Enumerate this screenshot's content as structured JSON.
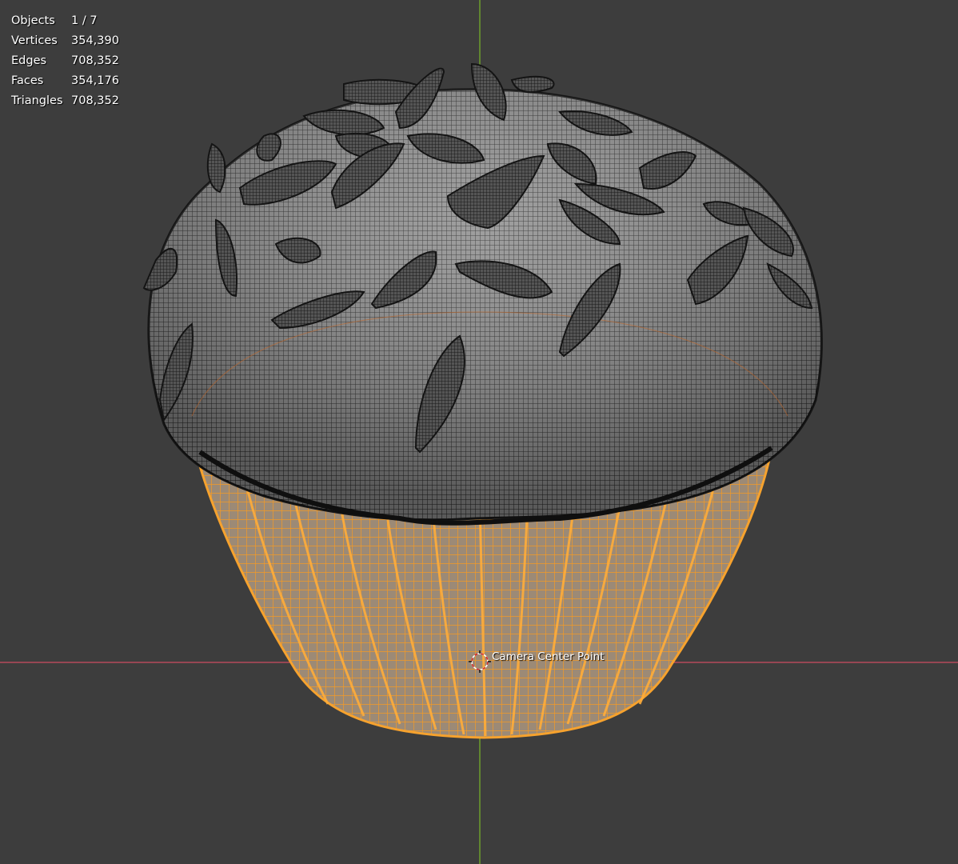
{
  "stats": [
    {
      "label": "Objects",
      "value": "1 / 7"
    },
    {
      "label": "Vertices",
      "value": "354,390"
    },
    {
      "label": "Edges",
      "value": "708,352"
    },
    {
      "label": "Faces",
      "value": "354,176"
    },
    {
      "label": "Triangles",
      "value": "708,352"
    }
  ],
  "origin": {
    "label": "Camera Center Point",
    "icon": "3d-cursor-icon"
  },
  "colors": {
    "background": "#3d3d3d",
    "x_axis": "#b5495b",
    "y_axis": "#6c9e2c",
    "selected_wire": "#f59b25",
    "mesh_wire": "#1e1e1e",
    "mesh_fill": "#8a8a8a"
  },
  "viewport": {
    "axes": [
      "x-axis",
      "y-axis"
    ],
    "objects": [
      {
        "name": "muffin-top",
        "selected": false
      },
      {
        "name": "paper-liner",
        "selected": true
      }
    ]
  }
}
